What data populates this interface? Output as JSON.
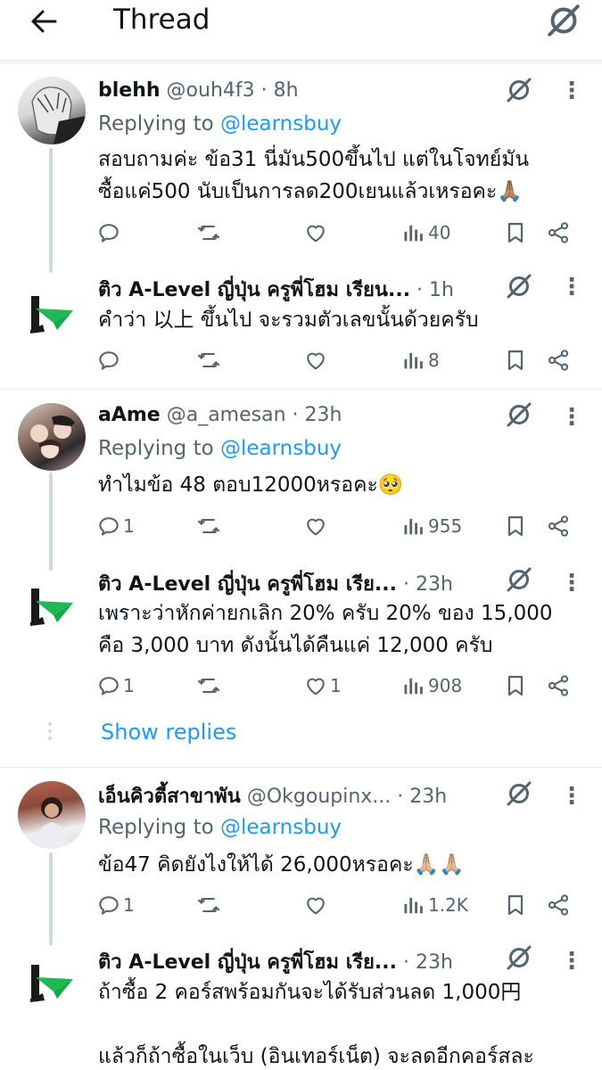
{
  "header": {
    "title": "Thread"
  },
  "tweets": [
    {
      "name": "blehh",
      "meta": "@ouh4f3 · 8h",
      "replying_prefix": "Replying to",
      "replying_handle": "@learnsbuy",
      "lines": [
        "สอบถามค่ะ ข้อ31 นี่มัน500ขึ้นไป แต่ในโจทย์มัน",
        "ซื้อแค่500 นับเป็นการลด200เยนแล้วเหรอคะ🙏🏽"
      ],
      "reply_count": "",
      "like_count": "",
      "views": "40"
    },
    {
      "name": "ติว A-Level ญี่ปุ่น ครูพี่โฮม เรียน...",
      "meta": "· 1h",
      "lines": [
        "คำว่า 以上 ขึ้นไป จะรวมตัวเลขนั้นด้วยครับ"
      ],
      "reply_count": "",
      "like_count": "",
      "views": "8"
    },
    {
      "name": "aAme",
      "meta": "@a_amesan · 23h",
      "replying_prefix": "Replying to",
      "replying_handle": "@learnsbuy",
      "lines": [
        "ทำไมข้อ 48 ตอบ12000หรอคะ🥺"
      ],
      "reply_count": "1",
      "like_count": "",
      "views": "955"
    },
    {
      "name": "ติว A-Level ญี่ปุ่น ครูพี่โฮม เรีย...",
      "meta": "· 23h",
      "lines": [
        "เพราะว่าหักค่ายกเลิก 20% ครับ 20% ของ 15,000",
        "คือ 3,000 บาท ดังนั้นได้คืนแค่ 12,000 ครับ"
      ],
      "reply_count": "1",
      "like_count": "1",
      "views": "908"
    },
    {
      "name": "เอ็นคิวตี้สาขาพัน",
      "meta": "@Okgoupinx... · 23h",
      "replying_prefix": "Replying to",
      "replying_handle": "@learnsbuy",
      "lines": [
        "ข้อ47 คิดยังไงให้ได้ 26,000หรอคะ🙏🏼🙏🏼"
      ],
      "reply_count": "1",
      "like_count": "",
      "views": "1.2K"
    },
    {
      "name": "ติว A-Level ญี่ปุ่น ครูพี่โฮม เรีย...",
      "meta": "· 23h",
      "lines": [
        "ถ้าซื้อ 2 คอร์สพร้อมกันจะได้รับส่วนลด 1,000円",
        "",
        "แล้วก็ถ้าซื้อในเว็บ (อินเทอร์เน็ต) จะลดอีกคอร์สละ"
      ]
    }
  ],
  "show_replies": "Show replies",
  "colors": {
    "accent": "#1d9bf0",
    "secondary_text": "#536471",
    "thread_line": "#cfd9de",
    "divider": "#e6ecf0"
  }
}
